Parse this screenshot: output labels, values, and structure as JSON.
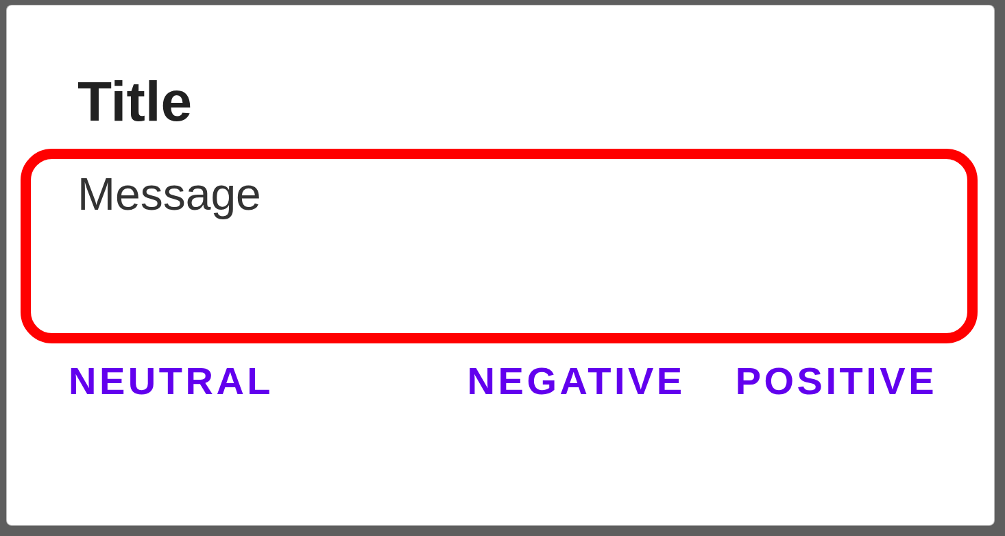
{
  "dialog": {
    "title": "Title",
    "message": {
      "text": "Message",
      "highlighted": true
    },
    "buttons": [
      {
        "label": "NEUTRAL",
        "kind": "neutral"
      },
      {
        "label": "NEGATIVE",
        "kind": "negative"
      },
      {
        "label": "POSITIVE",
        "kind": "positive"
      }
    ]
  }
}
